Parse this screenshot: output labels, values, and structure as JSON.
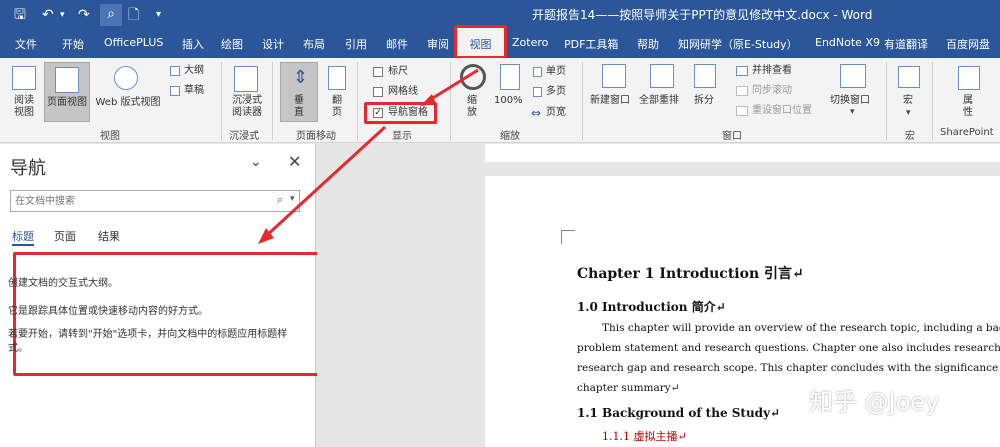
{
  "window": {
    "doc_title": "开题报告14——按照导师关于PPT的意见修改中文.docx - Word"
  },
  "tabs": [
    "文件",
    "开始",
    "OfficePLUS",
    "插入",
    "绘图",
    "设计",
    "布局",
    "引用",
    "邮件",
    "审阅",
    "视图",
    "Zotero",
    "PDF工具箱",
    "帮助",
    "知网研学（原E-Study）",
    "EndNote X9",
    "有道翻译",
    "百度网盘"
  ],
  "ribbon": {
    "views": {
      "read": "阅读\n视图",
      "print": "页面视图",
      "web": "Web 版式视图",
      "outline": "大纲",
      "draft": "草稿",
      "group": "视图"
    },
    "immersive": {
      "reader": "沉浸式\n阅读器",
      "group": "沉浸式"
    },
    "pagemove": {
      "vertical": "垂\n直",
      "side": "翻\n页",
      "group": "页面移动"
    },
    "show": {
      "ruler": "标尺",
      "grid": "网格线",
      "nav": "导航窗格",
      "group": "显示"
    },
    "zoom": {
      "zoom": "缩\n放",
      "pct": "100%",
      "one": "单页",
      "multi": "多页",
      "width": "页宽",
      "group": "缩放"
    },
    "window": {
      "new": "新建窗口",
      "arrange": "全部重排",
      "split": "拆分",
      "side": "并排查看",
      "sync": "同步滚动",
      "reset": "重设窗口位置",
      "switch": "切换窗口",
      "group": "窗口"
    },
    "macro": {
      "label": "宏",
      "group": "宏"
    },
    "sp": {
      "label": "属\n性",
      "group": "SharePoint"
    }
  },
  "nav": {
    "title": "导航",
    "search_placeholder": "在文档中搜索",
    "tabs": [
      "标题",
      "页面",
      "结果"
    ],
    "msg1": "创建文档的交互式大纲。",
    "msg2": "它是跟踪具体位置或快速移动内容的好方式。",
    "msg3": "若要开始，请转到\"开始\"选项卡，并向文档中的标题应用标题样式。"
  },
  "doc": {
    "h1": "Chapter 1 Introduction 引言↵",
    "h2a": "1.0 Introduction 简介↵",
    "p1": "This chapter will provide an overview of the research topic, including a back",
    "p2": "problem statement and research questions. Chapter one also includes research",
    "p3": "research gap and research scope. This chapter concludes with the significance of the",
    "p4": "chapter summary↵",
    "h2b": "1.1 Background of the Study↵",
    "h3": "1.1.1 虚拟主播↵"
  },
  "watermark": "知乎 @Joey",
  "colors": {
    "word_blue": "#2b579a",
    "highlight_red": "#e8282d"
  }
}
